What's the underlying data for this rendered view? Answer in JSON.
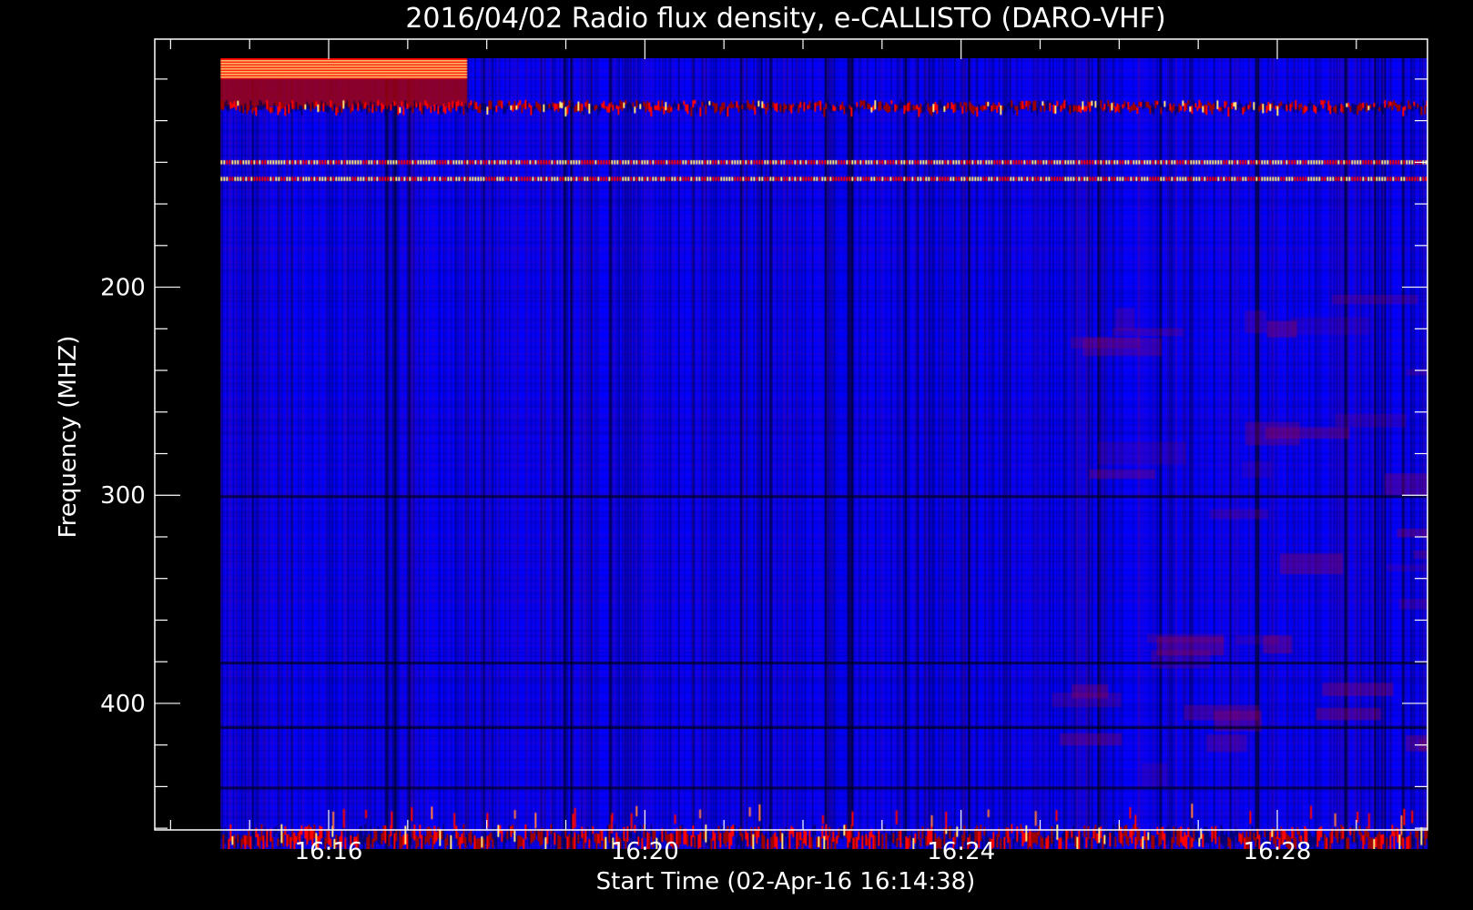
{
  "chart_data": {
    "type": "heatmap",
    "title": "2016/04/02  Radio flux density, e-CALLISTO (DARO-VHF)",
    "xlabel": "Start Time (02-Apr-16 16:14:38)",
    "ylabel": "Frequency (MHZ)",
    "x_start_minutes": 974.633,
    "x_end_minutes": 989.9,
    "xlim_minutes": [
      973.8,
      989.9
    ],
    "ylim": [
      90,
      470
    ],
    "x_tick_labels": [
      "16:16",
      "16:20",
      "16:24",
      "16:28"
    ],
    "x_ticks_minutes": [
      976,
      980,
      984,
      988
    ],
    "y_tick_labels": [
      "200",
      "300",
      "400"
    ],
    "y_ticks": [
      200,
      300,
      400
    ],
    "colormap": [
      "#000000",
      "#0000ff",
      "#9b0000",
      "#ff0000",
      "#ffe07a"
    ],
    "features": [
      {
        "name": "early-intense-low-frequency-band",
        "t": [
          974.633,
          977.75
        ],
        "f": [
          90,
          100
        ],
        "level": "saturated"
      },
      {
        "name": "interference-band-1",
        "t": [
          974.633,
          989.9
        ],
        "f": [
          139,
          141
        ],
        "level": "bright"
      },
      {
        "name": "interference-band-2",
        "t": [
          974.633,
          989.9
        ],
        "f": [
          147,
          149
        ],
        "level": "bright"
      },
      {
        "name": "scattered-noise-band",
        "t": [
          974.633,
          989.9
        ],
        "f": [
          110,
          116
        ],
        "level": "moderate"
      },
      {
        "name": "noisy-edge-band",
        "t": [
          974.633,
          989.9
        ],
        "f": [
          458,
          470
        ],
        "level": "moderate"
      }
    ]
  }
}
